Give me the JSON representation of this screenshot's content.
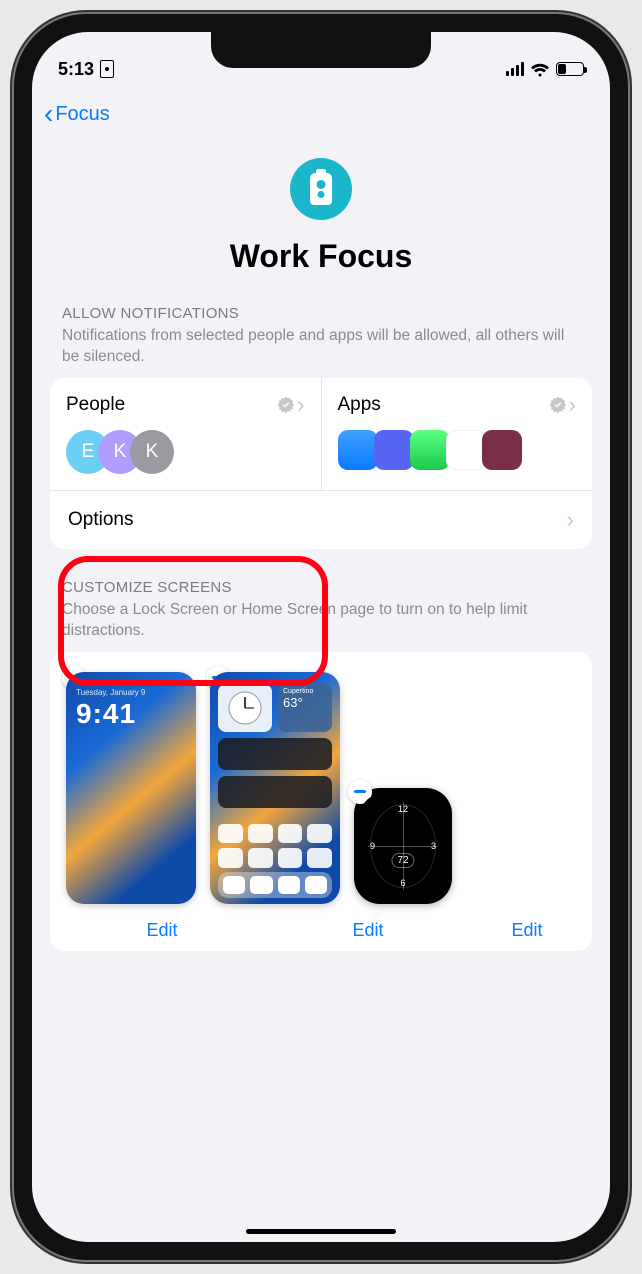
{
  "status": {
    "time": "5:13",
    "signal_bars": 4,
    "wifi": true,
    "battery_pct": 30
  },
  "nav": {
    "back_label": "Focus"
  },
  "header": {
    "title": "Work Focus",
    "icon": "badge-id"
  },
  "notifications": {
    "section_title": "Allow Notifications",
    "section_sub": "Notifications from selected people and apps will be allowed, all others will be silenced.",
    "people": {
      "label": "People",
      "avatars": [
        {
          "initial": "E",
          "color": "#6ccff6"
        },
        {
          "initial": "K",
          "color": "#b19dff"
        },
        {
          "initial": "K",
          "color": "#9a9aa1"
        }
      ]
    },
    "apps": {
      "label": "Apps",
      "icons": [
        {
          "name": "authenticator",
          "color": "#0a7aff"
        },
        {
          "name": "discord",
          "color": "#5865f2"
        },
        {
          "name": "facetime",
          "color": "#34c759"
        },
        {
          "name": "gmail",
          "color": "#ffffff"
        },
        {
          "name": "books",
          "color": "#7a2e4a"
        }
      ]
    },
    "options_label": "Options"
  },
  "customize": {
    "section_title": "Customize Screens",
    "section_sub": "Choose a Lock Screen or Home Screen page to turn on to help limit distractions.",
    "lockscreen": {
      "date": "Tuesday, January 9",
      "time": "9:41"
    },
    "homescreen": {
      "weather": {
        "city": "Cupertino",
        "temp": "63°"
      }
    },
    "watch": {
      "temp": "72",
      "numerals": [
        "12",
        "3",
        "6",
        "9"
      ]
    },
    "edit_label": "Edit"
  },
  "annotation": {
    "highlight_target": "people-pane"
  }
}
